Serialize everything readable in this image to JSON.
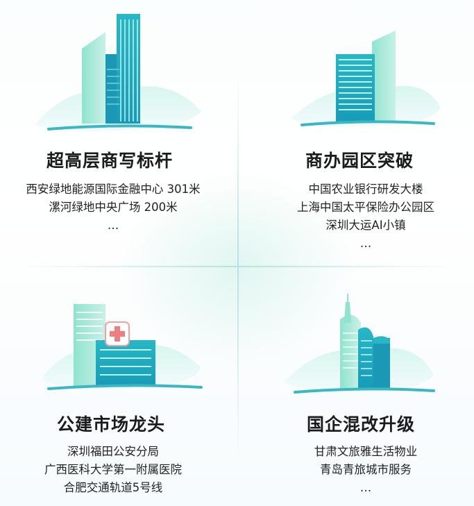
{
  "quadrants": [
    {
      "title": "超高层商写标杆",
      "items": [
        "西安绿地能源国际金融中心 301米",
        "漯河绿地中央广场 200米",
        "…"
      ]
    },
    {
      "title": "商办园区突破",
      "items": [
        "中国农业银行研发大楼",
        "上海中国太平保险办公园区",
        "深圳大运AI小镇",
        "…"
      ]
    },
    {
      "title": "公建市场龙头",
      "items": [
        "深圳福田公安分局",
        "广西医科大学第一附属医院",
        "合肥交通轨道5号线"
      ]
    },
    {
      "title": "国企混改升级",
      "items": [
        "甘肃文旅雅生活物业",
        "青岛青旅城市服务",
        "…"
      ]
    }
  ],
  "colors": {
    "teal_dark": "#1fa9bf",
    "teal_light": "#8fe3d0",
    "text": "#222222",
    "title": "#1b1b1b"
  },
  "icons": [
    "skyscraper-illustration",
    "office-park-illustration",
    "hospital-illustration",
    "city-towers-illustration"
  ]
}
